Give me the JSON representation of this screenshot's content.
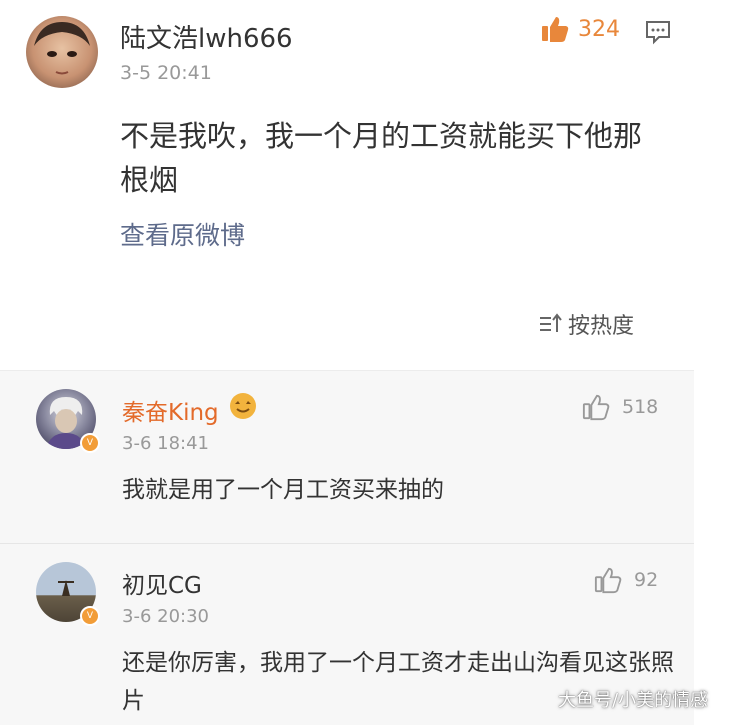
{
  "main_comment": {
    "username": "陆文浩lwh666",
    "time": "3-5 20:41",
    "like_count": "324",
    "content": "不是我吹，我一个月的工资就能买下他那根烟",
    "view_original": "查看原微博",
    "sort_label": "按热度"
  },
  "replies": [
    {
      "username": "秦奋King",
      "time": "3-6 18:41",
      "like_count": "518",
      "text": "我就是用了一个月工资买来抽的"
    },
    {
      "username": "初见CG",
      "time": "3-6 20:30",
      "like_count": "92",
      "text": "还是你厉害，我用了一个月工资才走出山沟看见这张照片"
    }
  ],
  "watermark": "大鱼号/小美的情感",
  "colors": {
    "accent_orange": "#e8873b",
    "link_blue_gray": "#5e6b8b",
    "vip_name": "#e36a2a"
  }
}
